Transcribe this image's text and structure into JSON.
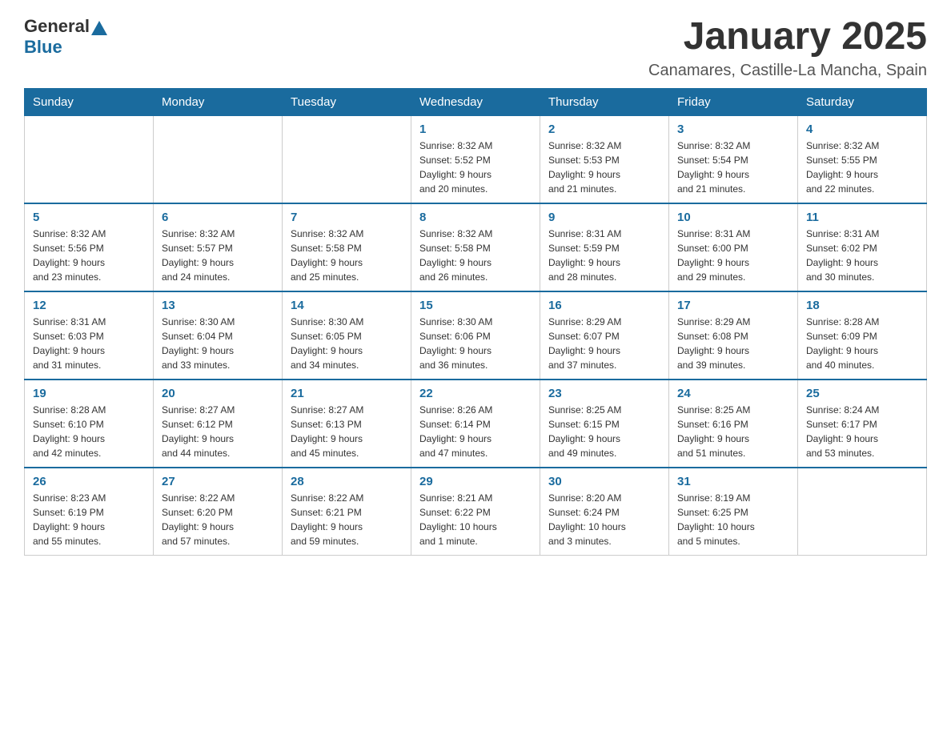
{
  "header": {
    "logo": {
      "general": "General",
      "blue": "Blue"
    },
    "title": "January 2025",
    "location": "Canamares, Castille-La Mancha, Spain"
  },
  "days_of_week": [
    "Sunday",
    "Monday",
    "Tuesday",
    "Wednesday",
    "Thursday",
    "Friday",
    "Saturday"
  ],
  "weeks": [
    [
      {
        "day": "",
        "info": ""
      },
      {
        "day": "",
        "info": ""
      },
      {
        "day": "",
        "info": ""
      },
      {
        "day": "1",
        "info": "Sunrise: 8:32 AM\nSunset: 5:52 PM\nDaylight: 9 hours\nand 20 minutes."
      },
      {
        "day": "2",
        "info": "Sunrise: 8:32 AM\nSunset: 5:53 PM\nDaylight: 9 hours\nand 21 minutes."
      },
      {
        "day": "3",
        "info": "Sunrise: 8:32 AM\nSunset: 5:54 PM\nDaylight: 9 hours\nand 21 minutes."
      },
      {
        "day": "4",
        "info": "Sunrise: 8:32 AM\nSunset: 5:55 PM\nDaylight: 9 hours\nand 22 minutes."
      }
    ],
    [
      {
        "day": "5",
        "info": "Sunrise: 8:32 AM\nSunset: 5:56 PM\nDaylight: 9 hours\nand 23 minutes."
      },
      {
        "day": "6",
        "info": "Sunrise: 8:32 AM\nSunset: 5:57 PM\nDaylight: 9 hours\nand 24 minutes."
      },
      {
        "day": "7",
        "info": "Sunrise: 8:32 AM\nSunset: 5:58 PM\nDaylight: 9 hours\nand 25 minutes."
      },
      {
        "day": "8",
        "info": "Sunrise: 8:32 AM\nSunset: 5:58 PM\nDaylight: 9 hours\nand 26 minutes."
      },
      {
        "day": "9",
        "info": "Sunrise: 8:31 AM\nSunset: 5:59 PM\nDaylight: 9 hours\nand 28 minutes."
      },
      {
        "day": "10",
        "info": "Sunrise: 8:31 AM\nSunset: 6:00 PM\nDaylight: 9 hours\nand 29 minutes."
      },
      {
        "day": "11",
        "info": "Sunrise: 8:31 AM\nSunset: 6:02 PM\nDaylight: 9 hours\nand 30 minutes."
      }
    ],
    [
      {
        "day": "12",
        "info": "Sunrise: 8:31 AM\nSunset: 6:03 PM\nDaylight: 9 hours\nand 31 minutes."
      },
      {
        "day": "13",
        "info": "Sunrise: 8:30 AM\nSunset: 6:04 PM\nDaylight: 9 hours\nand 33 minutes."
      },
      {
        "day": "14",
        "info": "Sunrise: 8:30 AM\nSunset: 6:05 PM\nDaylight: 9 hours\nand 34 minutes."
      },
      {
        "day": "15",
        "info": "Sunrise: 8:30 AM\nSunset: 6:06 PM\nDaylight: 9 hours\nand 36 minutes."
      },
      {
        "day": "16",
        "info": "Sunrise: 8:29 AM\nSunset: 6:07 PM\nDaylight: 9 hours\nand 37 minutes."
      },
      {
        "day": "17",
        "info": "Sunrise: 8:29 AM\nSunset: 6:08 PM\nDaylight: 9 hours\nand 39 minutes."
      },
      {
        "day": "18",
        "info": "Sunrise: 8:28 AM\nSunset: 6:09 PM\nDaylight: 9 hours\nand 40 minutes."
      }
    ],
    [
      {
        "day": "19",
        "info": "Sunrise: 8:28 AM\nSunset: 6:10 PM\nDaylight: 9 hours\nand 42 minutes."
      },
      {
        "day": "20",
        "info": "Sunrise: 8:27 AM\nSunset: 6:12 PM\nDaylight: 9 hours\nand 44 minutes."
      },
      {
        "day": "21",
        "info": "Sunrise: 8:27 AM\nSunset: 6:13 PM\nDaylight: 9 hours\nand 45 minutes."
      },
      {
        "day": "22",
        "info": "Sunrise: 8:26 AM\nSunset: 6:14 PM\nDaylight: 9 hours\nand 47 minutes."
      },
      {
        "day": "23",
        "info": "Sunrise: 8:25 AM\nSunset: 6:15 PM\nDaylight: 9 hours\nand 49 minutes."
      },
      {
        "day": "24",
        "info": "Sunrise: 8:25 AM\nSunset: 6:16 PM\nDaylight: 9 hours\nand 51 minutes."
      },
      {
        "day": "25",
        "info": "Sunrise: 8:24 AM\nSunset: 6:17 PM\nDaylight: 9 hours\nand 53 minutes."
      }
    ],
    [
      {
        "day": "26",
        "info": "Sunrise: 8:23 AM\nSunset: 6:19 PM\nDaylight: 9 hours\nand 55 minutes."
      },
      {
        "day": "27",
        "info": "Sunrise: 8:22 AM\nSunset: 6:20 PM\nDaylight: 9 hours\nand 57 minutes."
      },
      {
        "day": "28",
        "info": "Sunrise: 8:22 AM\nSunset: 6:21 PM\nDaylight: 9 hours\nand 59 minutes."
      },
      {
        "day": "29",
        "info": "Sunrise: 8:21 AM\nSunset: 6:22 PM\nDaylight: 10 hours\nand 1 minute."
      },
      {
        "day": "30",
        "info": "Sunrise: 8:20 AM\nSunset: 6:24 PM\nDaylight: 10 hours\nand 3 minutes."
      },
      {
        "day": "31",
        "info": "Sunrise: 8:19 AM\nSunset: 6:25 PM\nDaylight: 10 hours\nand 5 minutes."
      },
      {
        "day": "",
        "info": ""
      }
    ]
  ]
}
